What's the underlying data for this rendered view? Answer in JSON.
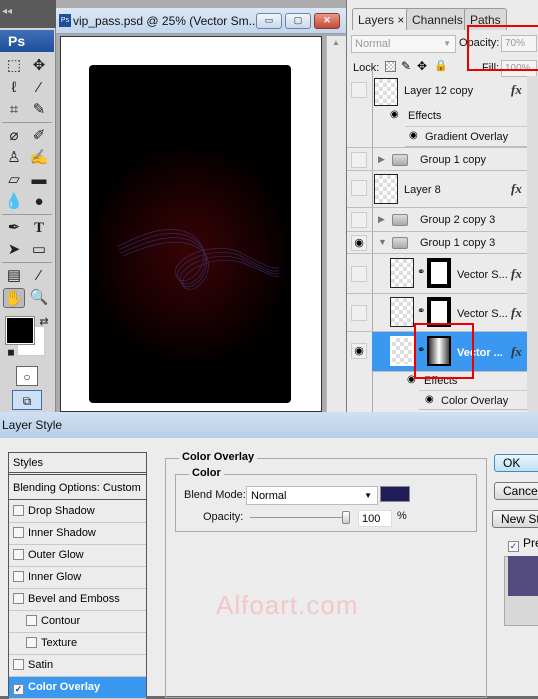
{
  "toolbox": {
    "collapse_label": "◂◂",
    "logo": "Ps",
    "tools": [
      "marquee-tool",
      "move-tool",
      "lasso-tool",
      "quick-selection-tool",
      "crop-tool",
      "slice-tool",
      "healing-brush-tool",
      "brush-tool",
      "clone-stamp-tool",
      "history-brush-tool",
      "eraser-tool",
      "gradient-tool",
      "blur-tool",
      "dodge-tool",
      "pen-tool",
      "type-tool",
      "path-selection-tool",
      "shape-tool",
      "notes-tool",
      "eyedropper-tool",
      "hand-tool",
      "zoom-tool"
    ],
    "foreground_color": "#000000",
    "background_color": "#ffffff"
  },
  "document": {
    "title": "vip_pass.psd @ 25% (Vector Sm...",
    "minimize": "▭",
    "maximize": "▢",
    "close": "✕"
  },
  "layers_panel": {
    "tabs": [
      {
        "label": "Layers ×",
        "active": true
      },
      {
        "label": "Channels",
        "active": false
      },
      {
        "label": "Paths",
        "active": false
      }
    ],
    "blend_mode": "Normal",
    "opacity_label": "Opacity:",
    "opacity_value": "70%",
    "lock_label": "Lock:",
    "fill_label": "Fill:",
    "fill_value": "100%",
    "layers": [
      {
        "name": "Layer 12 copy",
        "visible": false,
        "fx": "fx"
      },
      {
        "name": "Effects",
        "type": "effects"
      },
      {
        "name": "Gradient Overlay",
        "type": "effect"
      },
      {
        "name": "Group 1 copy",
        "type": "group",
        "visible": false
      },
      {
        "name": "Layer 8",
        "visible": false,
        "fx": "fx"
      },
      {
        "name": "Group 2 copy 3",
        "type": "group",
        "visible": false
      },
      {
        "name": "Group 1 copy 3",
        "type": "group",
        "visible": true,
        "expanded": true
      },
      {
        "name": "Vector S...",
        "visible": false,
        "fx": "fx"
      },
      {
        "name": "Vector S...",
        "visible": false,
        "fx": "fx"
      },
      {
        "name": "Vector ...",
        "visible": true,
        "fx": "fx",
        "selected": true
      },
      {
        "name": "Effects",
        "type": "effects"
      },
      {
        "name": "Color Overlay",
        "type": "effect"
      }
    ]
  },
  "dialog": {
    "title": "Layer Style",
    "styles": [
      {
        "label": "Styles",
        "checkbox": false
      },
      {
        "label": "Blending Options: Custom",
        "checkbox": false
      },
      {
        "label": "Drop Shadow",
        "checked": false
      },
      {
        "label": "Inner Shadow",
        "checked": false
      },
      {
        "label": "Outer Glow",
        "checked": false
      },
      {
        "label": "Inner Glow",
        "checked": false
      },
      {
        "label": "Bevel and Emboss",
        "checked": false
      },
      {
        "label": "Contour",
        "checked": false,
        "indent": true
      },
      {
        "label": "Texture",
        "checked": false,
        "indent": true
      },
      {
        "label": "Satin",
        "checked": false
      },
      {
        "label": "Color Overlay",
        "checked": true,
        "selected": true
      }
    ],
    "section_title": "Color Overlay",
    "subsection_title": "Color",
    "blend_mode_label": "Blend Mode:",
    "blend_mode_value": "Normal",
    "overlay_color": "#201d58",
    "opacity_label": "Opacity:",
    "opacity_value": "100",
    "opacity_unit": "%",
    "buttons": {
      "ok": "OK",
      "cancel": "Cancel",
      "new_style": "New Style..."
    },
    "preview_label": "Preview",
    "preview_checked": true,
    "preview_color": "#544c80",
    "watermark": "Alfoart.com"
  }
}
